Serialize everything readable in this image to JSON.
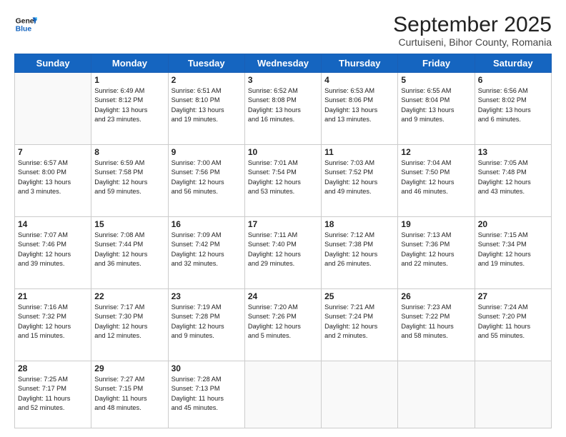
{
  "header": {
    "logo_line1": "General",
    "logo_line2": "Blue",
    "month": "September 2025",
    "location": "Curtuiseni, Bihor County, Romania"
  },
  "weekdays": [
    "Sunday",
    "Monday",
    "Tuesday",
    "Wednesday",
    "Thursday",
    "Friday",
    "Saturday"
  ],
  "weeks": [
    [
      {
        "day": "",
        "info": ""
      },
      {
        "day": "1",
        "info": "Sunrise: 6:49 AM\nSunset: 8:12 PM\nDaylight: 13 hours\nand 23 minutes."
      },
      {
        "day": "2",
        "info": "Sunrise: 6:51 AM\nSunset: 8:10 PM\nDaylight: 13 hours\nand 19 minutes."
      },
      {
        "day": "3",
        "info": "Sunrise: 6:52 AM\nSunset: 8:08 PM\nDaylight: 13 hours\nand 16 minutes."
      },
      {
        "day": "4",
        "info": "Sunrise: 6:53 AM\nSunset: 8:06 PM\nDaylight: 13 hours\nand 13 minutes."
      },
      {
        "day": "5",
        "info": "Sunrise: 6:55 AM\nSunset: 8:04 PM\nDaylight: 13 hours\nand 9 minutes."
      },
      {
        "day": "6",
        "info": "Sunrise: 6:56 AM\nSunset: 8:02 PM\nDaylight: 13 hours\nand 6 minutes."
      }
    ],
    [
      {
        "day": "7",
        "info": "Sunrise: 6:57 AM\nSunset: 8:00 PM\nDaylight: 13 hours\nand 3 minutes."
      },
      {
        "day": "8",
        "info": "Sunrise: 6:59 AM\nSunset: 7:58 PM\nDaylight: 12 hours\nand 59 minutes."
      },
      {
        "day": "9",
        "info": "Sunrise: 7:00 AM\nSunset: 7:56 PM\nDaylight: 12 hours\nand 56 minutes."
      },
      {
        "day": "10",
        "info": "Sunrise: 7:01 AM\nSunset: 7:54 PM\nDaylight: 12 hours\nand 53 minutes."
      },
      {
        "day": "11",
        "info": "Sunrise: 7:03 AM\nSunset: 7:52 PM\nDaylight: 12 hours\nand 49 minutes."
      },
      {
        "day": "12",
        "info": "Sunrise: 7:04 AM\nSunset: 7:50 PM\nDaylight: 12 hours\nand 46 minutes."
      },
      {
        "day": "13",
        "info": "Sunrise: 7:05 AM\nSunset: 7:48 PM\nDaylight: 12 hours\nand 43 minutes."
      }
    ],
    [
      {
        "day": "14",
        "info": "Sunrise: 7:07 AM\nSunset: 7:46 PM\nDaylight: 12 hours\nand 39 minutes."
      },
      {
        "day": "15",
        "info": "Sunrise: 7:08 AM\nSunset: 7:44 PM\nDaylight: 12 hours\nand 36 minutes."
      },
      {
        "day": "16",
        "info": "Sunrise: 7:09 AM\nSunset: 7:42 PM\nDaylight: 12 hours\nand 32 minutes."
      },
      {
        "day": "17",
        "info": "Sunrise: 7:11 AM\nSunset: 7:40 PM\nDaylight: 12 hours\nand 29 minutes."
      },
      {
        "day": "18",
        "info": "Sunrise: 7:12 AM\nSunset: 7:38 PM\nDaylight: 12 hours\nand 26 minutes."
      },
      {
        "day": "19",
        "info": "Sunrise: 7:13 AM\nSunset: 7:36 PM\nDaylight: 12 hours\nand 22 minutes."
      },
      {
        "day": "20",
        "info": "Sunrise: 7:15 AM\nSunset: 7:34 PM\nDaylight: 12 hours\nand 19 minutes."
      }
    ],
    [
      {
        "day": "21",
        "info": "Sunrise: 7:16 AM\nSunset: 7:32 PM\nDaylight: 12 hours\nand 15 minutes."
      },
      {
        "day": "22",
        "info": "Sunrise: 7:17 AM\nSunset: 7:30 PM\nDaylight: 12 hours\nand 12 minutes."
      },
      {
        "day": "23",
        "info": "Sunrise: 7:19 AM\nSunset: 7:28 PM\nDaylight: 12 hours\nand 9 minutes."
      },
      {
        "day": "24",
        "info": "Sunrise: 7:20 AM\nSunset: 7:26 PM\nDaylight: 12 hours\nand 5 minutes."
      },
      {
        "day": "25",
        "info": "Sunrise: 7:21 AM\nSunset: 7:24 PM\nDaylight: 12 hours\nand 2 minutes."
      },
      {
        "day": "26",
        "info": "Sunrise: 7:23 AM\nSunset: 7:22 PM\nDaylight: 11 hours\nand 58 minutes."
      },
      {
        "day": "27",
        "info": "Sunrise: 7:24 AM\nSunset: 7:20 PM\nDaylight: 11 hours\nand 55 minutes."
      }
    ],
    [
      {
        "day": "28",
        "info": "Sunrise: 7:25 AM\nSunset: 7:17 PM\nDaylight: 11 hours\nand 52 minutes."
      },
      {
        "day": "29",
        "info": "Sunrise: 7:27 AM\nSunset: 7:15 PM\nDaylight: 11 hours\nand 48 minutes."
      },
      {
        "day": "30",
        "info": "Sunrise: 7:28 AM\nSunset: 7:13 PM\nDaylight: 11 hours\nand 45 minutes."
      },
      {
        "day": "",
        "info": ""
      },
      {
        "day": "",
        "info": ""
      },
      {
        "day": "",
        "info": ""
      },
      {
        "day": "",
        "info": ""
      }
    ]
  ]
}
